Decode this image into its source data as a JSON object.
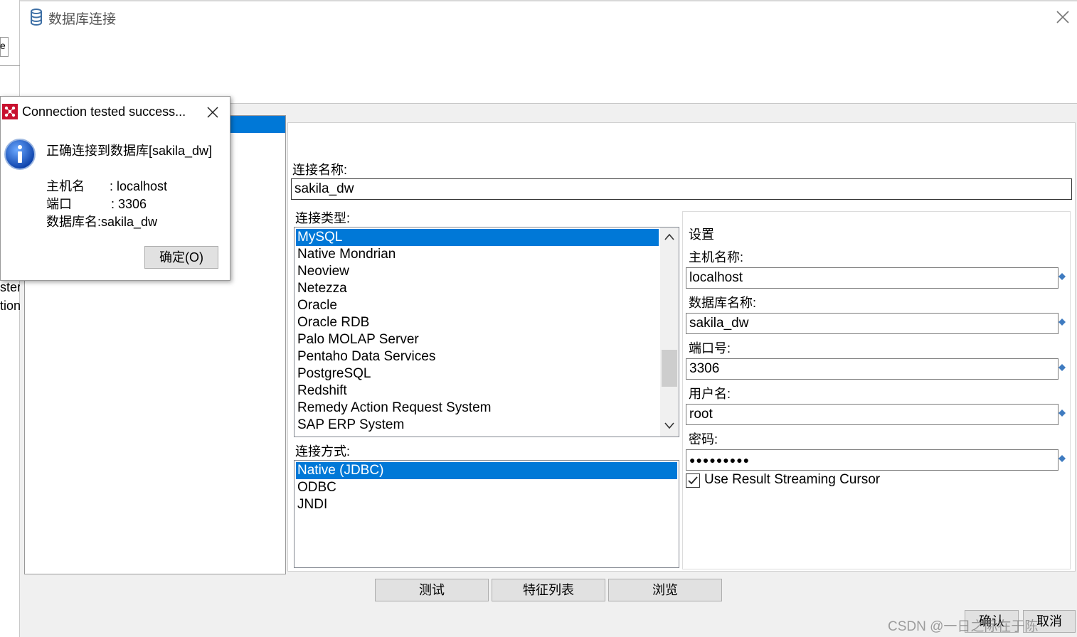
{
  "background_app": {
    "frag1": "e",
    "frag2": "ster",
    "frag3": "tion"
  },
  "dialog": {
    "title": "数据库连接",
    "icon": "database-icon",
    "close_icon": "close-icon"
  },
  "form": {
    "connection_name_label": "连接名称:",
    "connection_name_value": "sakila_dw",
    "connection_type_label": "连接类型:",
    "connection_types": [
      "MySQL",
      "Native Mondrian",
      "Neoview",
      "Netezza",
      "Oracle",
      "Oracle RDB",
      "Palo MOLAP Server",
      "Pentaho Data Services",
      "PostgreSQL",
      "Redshift",
      "Remedy Action Request System",
      "SAP ERP System"
    ],
    "connection_type_selected": "MySQL",
    "access_label": "连接方式:",
    "access_methods": [
      "Native (JDBC)",
      "ODBC",
      "JNDI"
    ],
    "access_selected": "Native (JDBC)"
  },
  "settings": {
    "group_label": "设置",
    "host_label": "主机名称:",
    "host_value": "localhost",
    "db_label": "数据库名称:",
    "db_value": "sakila_dw",
    "port_label": "端口号:",
    "port_value": "3306",
    "user_label": "用户名:",
    "user_value": "root",
    "password_label": "密码:",
    "password_value": "●●●●●●●●●",
    "streaming_label": "Use Result Streaming Cursor",
    "streaming_checked": true
  },
  "buttons": {
    "test": "测试",
    "features": "特征列表",
    "explore": "浏览",
    "ok": "确认",
    "cancel": "取消"
  },
  "popup": {
    "title": "Connection tested success...",
    "message": "正确连接到数据库[sakila_dw]",
    "host_line": "主机名       : localhost",
    "port_line": "端口           : 3306",
    "db_line": "数据库名:sakila_dw",
    "ok_button": "确定(O)",
    "info_icon": "info-icon"
  },
  "watermark": "CSDN @一日之际在于陈",
  "colors": {
    "selection": "#0078d7",
    "button_face": "#e1e1e1"
  }
}
